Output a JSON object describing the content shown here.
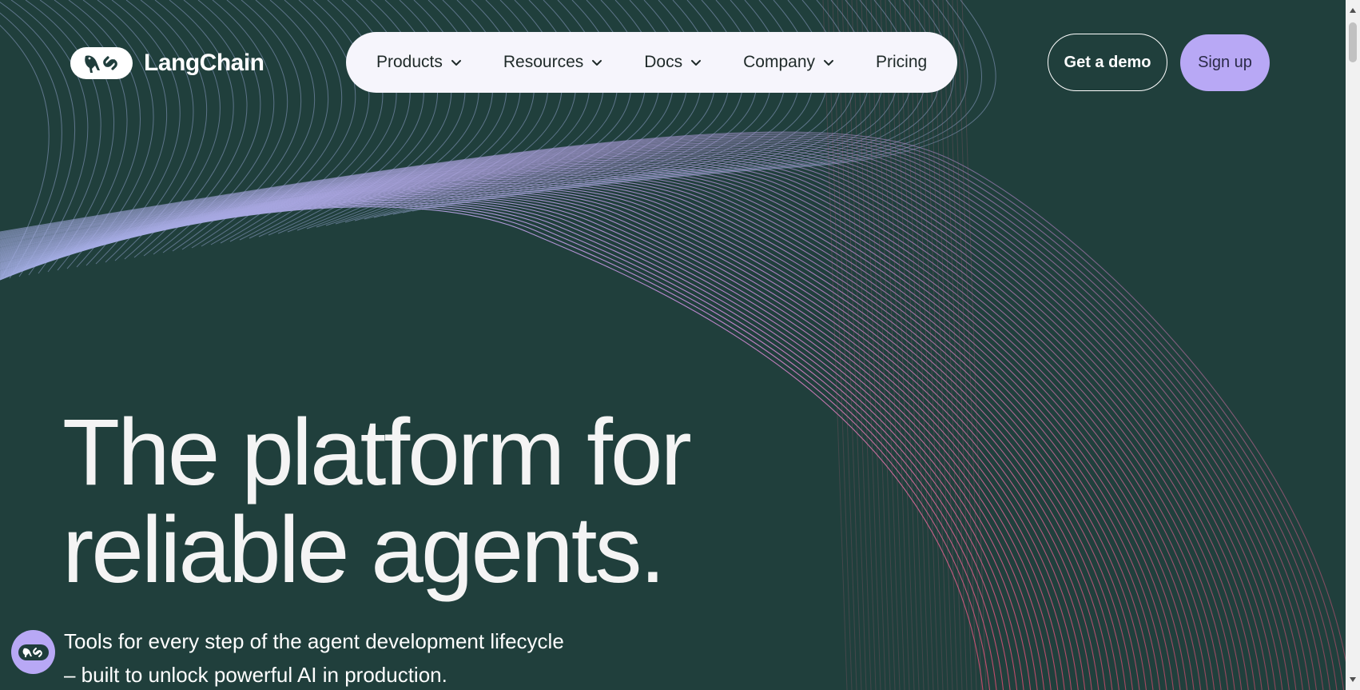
{
  "brand": {
    "name": "LangChain"
  },
  "nav": {
    "items": [
      {
        "label": "Products",
        "has_dropdown": true
      },
      {
        "label": "Resources",
        "has_dropdown": true
      },
      {
        "label": "Docs",
        "has_dropdown": true
      },
      {
        "label": "Company",
        "has_dropdown": true
      },
      {
        "label": "Pricing",
        "has_dropdown": false
      }
    ]
  },
  "actions": {
    "demo_label": "Get a demo",
    "signup_label": "Sign up"
  },
  "hero": {
    "title_line1": "The platform for",
    "title_line2": "reliable agents.",
    "subtitle_line1": "Tools for every step of the agent development lifecycle",
    "subtitle_line2": "– built to unlock powerful AI in production."
  },
  "colors": {
    "background": "#203f3c",
    "nav_pill": "#f6f5fc",
    "accent_lavender": "#b8a8f5",
    "wave_pink": "#d46a9a",
    "wave_blue": "#9cb4e6"
  }
}
